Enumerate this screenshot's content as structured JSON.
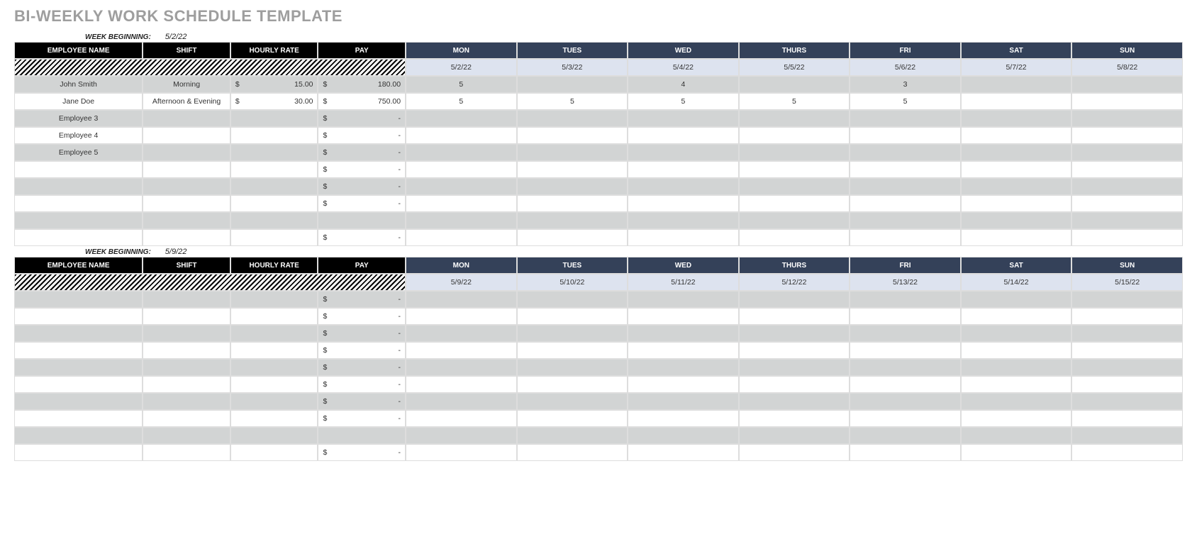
{
  "title": "BI-WEEKLY WORK SCHEDULE TEMPLATE",
  "week_label": "WEEK BEGINNING:",
  "currency": "$",
  "dash": "-",
  "columns_left": [
    "EMPLOYEE NAME",
    "SHIFT",
    "HOURLY RATE",
    "PAY"
  ],
  "days": [
    "MON",
    "TUES",
    "WED",
    "THURS",
    "FRI",
    "SAT",
    "SUN"
  ],
  "weeks": [
    {
      "start": "5/2/22",
      "dates": [
        "5/2/22",
        "5/3/22",
        "5/4/22",
        "5/5/22",
        "5/6/22",
        "5/7/22",
        "5/8/22"
      ],
      "rows": [
        {
          "name": "John Smith",
          "shift": "Morning",
          "rate": "15.00",
          "pay": "180.00",
          "h": [
            "5",
            "",
            "4",
            "",
            "3",
            "",
            ""
          ]
        },
        {
          "name": "Jane Doe",
          "shift": "Afternoon & Evening",
          "rate": "30.00",
          "pay": "750.00",
          "h": [
            "5",
            "5",
            "5",
            "5",
            "5",
            "",
            ""
          ]
        },
        {
          "name": "Employee 3",
          "shift": "",
          "rate": "",
          "pay": "-",
          "h": [
            "",
            "",
            "",
            "",
            "",
            "",
            ""
          ]
        },
        {
          "name": "Employee 4",
          "shift": "",
          "rate": "",
          "pay": "-",
          "h": [
            "",
            "",
            "",
            "",
            "",
            "",
            ""
          ]
        },
        {
          "name": "Employee 5",
          "shift": "",
          "rate": "",
          "pay": "-",
          "h": [
            "",
            "",
            "",
            "",
            "",
            "",
            ""
          ]
        },
        {
          "name": "",
          "shift": "",
          "rate": "",
          "pay": "-",
          "h": [
            "",
            "",
            "",
            "",
            "",
            "",
            ""
          ]
        },
        {
          "name": "",
          "shift": "",
          "rate": "",
          "pay": "-",
          "h": [
            "",
            "",
            "",
            "",
            "",
            "",
            ""
          ]
        },
        {
          "name": "",
          "shift": "",
          "rate": "",
          "pay": "-",
          "h": [
            "",
            "",
            "",
            "",
            "",
            "",
            ""
          ]
        },
        {
          "name": "",
          "shift": "",
          "rate": "",
          "pay": "",
          "h": [
            "",
            "",
            "",
            "",
            "",
            "",
            ""
          ],
          "blank": true
        },
        {
          "name": "",
          "shift": "",
          "rate": "",
          "pay": "-",
          "h": [
            "",
            "",
            "",
            "",
            "",
            "",
            ""
          ]
        }
      ]
    },
    {
      "start": "5/9/22",
      "dates": [
        "5/9/22",
        "5/10/22",
        "5/11/22",
        "5/12/22",
        "5/13/22",
        "5/14/22",
        "5/15/22"
      ],
      "rows": [
        {
          "name": "",
          "shift": "",
          "rate": "",
          "pay": "-",
          "h": [
            "",
            "",
            "",
            "",
            "",
            "",
            ""
          ]
        },
        {
          "name": "",
          "shift": "",
          "rate": "",
          "pay": "-",
          "h": [
            "",
            "",
            "",
            "",
            "",
            "",
            ""
          ]
        },
        {
          "name": "",
          "shift": "",
          "rate": "",
          "pay": "-",
          "h": [
            "",
            "",
            "",
            "",
            "",
            "",
            ""
          ]
        },
        {
          "name": "",
          "shift": "",
          "rate": "",
          "pay": "-",
          "h": [
            "",
            "",
            "",
            "",
            "",
            "",
            ""
          ]
        },
        {
          "name": "",
          "shift": "",
          "rate": "",
          "pay": "-",
          "h": [
            "",
            "",
            "",
            "",
            "",
            "",
            ""
          ]
        },
        {
          "name": "",
          "shift": "",
          "rate": "",
          "pay": "-",
          "h": [
            "",
            "",
            "",
            "",
            "",
            "",
            ""
          ]
        },
        {
          "name": "",
          "shift": "",
          "rate": "",
          "pay": "-",
          "h": [
            "",
            "",
            "",
            "",
            "",
            "",
            ""
          ]
        },
        {
          "name": "",
          "shift": "",
          "rate": "",
          "pay": "-",
          "h": [
            "",
            "",
            "",
            "",
            "",
            "",
            ""
          ]
        },
        {
          "name": "",
          "shift": "",
          "rate": "",
          "pay": "",
          "h": [
            "",
            "",
            "",
            "",
            "",
            "",
            ""
          ],
          "blank": true
        },
        {
          "name": "",
          "shift": "",
          "rate": "",
          "pay": "-",
          "h": [
            "",
            "",
            "",
            "",
            "",
            "",
            ""
          ]
        }
      ]
    }
  ]
}
